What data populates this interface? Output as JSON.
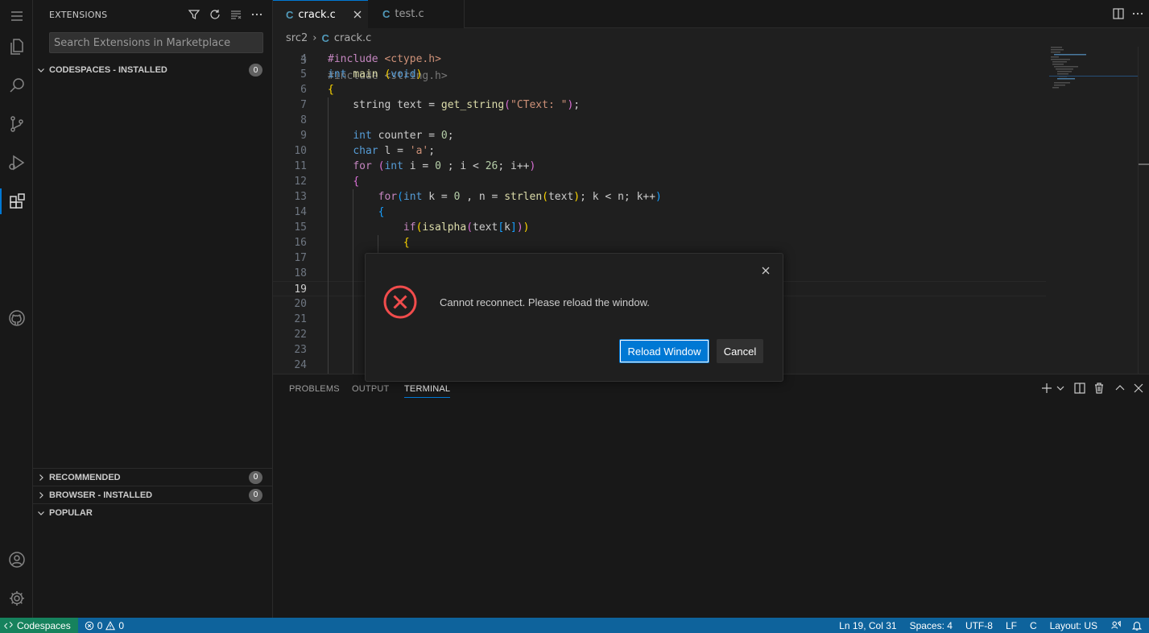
{
  "sidebar": {
    "title": "EXTENSIONS",
    "search_placeholder": "Search Extensions in Marketplace",
    "sections": [
      {
        "label": "CODESPACES - INSTALLED",
        "count": "0"
      },
      {
        "label": "RECOMMENDED",
        "count": "0"
      },
      {
        "label": "BROWSER - INSTALLED",
        "count": "0"
      },
      {
        "label": "POPULAR"
      }
    ]
  },
  "tabs": [
    {
      "icon_text": "C",
      "label": "crack.c"
    },
    {
      "icon_text": "C",
      "label": "test.c"
    }
  ],
  "breadcrumb": {
    "folder": "src2",
    "icon_text": "C",
    "file": "crack.c"
  },
  "editor": {
    "line_numbers": [
      "3",
      "4",
      "5",
      "6",
      "7",
      "8",
      "9",
      "10",
      "11",
      "12",
      "13",
      "14",
      "15",
      "16",
      "17",
      "18",
      "19",
      "20",
      "21",
      "22",
      "23",
      "24"
    ],
    "top_partial": "#include <string.h>"
  },
  "panel": {
    "tabs": [
      "PROBLEMS",
      "OUTPUT",
      "TERMINAL"
    ]
  },
  "dialog": {
    "message": "Cannot reconnect. Please reload the window.",
    "primary_button": "Reload Window",
    "secondary_button": "Cancel"
  },
  "status": {
    "remote": "Codespaces",
    "errors": "0",
    "warnings": "0",
    "position": "Ln 19, Col 31",
    "spaces": "Spaces: 4",
    "encoding": "UTF-8",
    "eol": "LF",
    "language": "C",
    "layout": "Layout: US"
  },
  "colors": {
    "accent": "#0078d4",
    "status_bg": "#0e639c",
    "remote_bg": "#16825d",
    "error": "#f14c4c"
  }
}
